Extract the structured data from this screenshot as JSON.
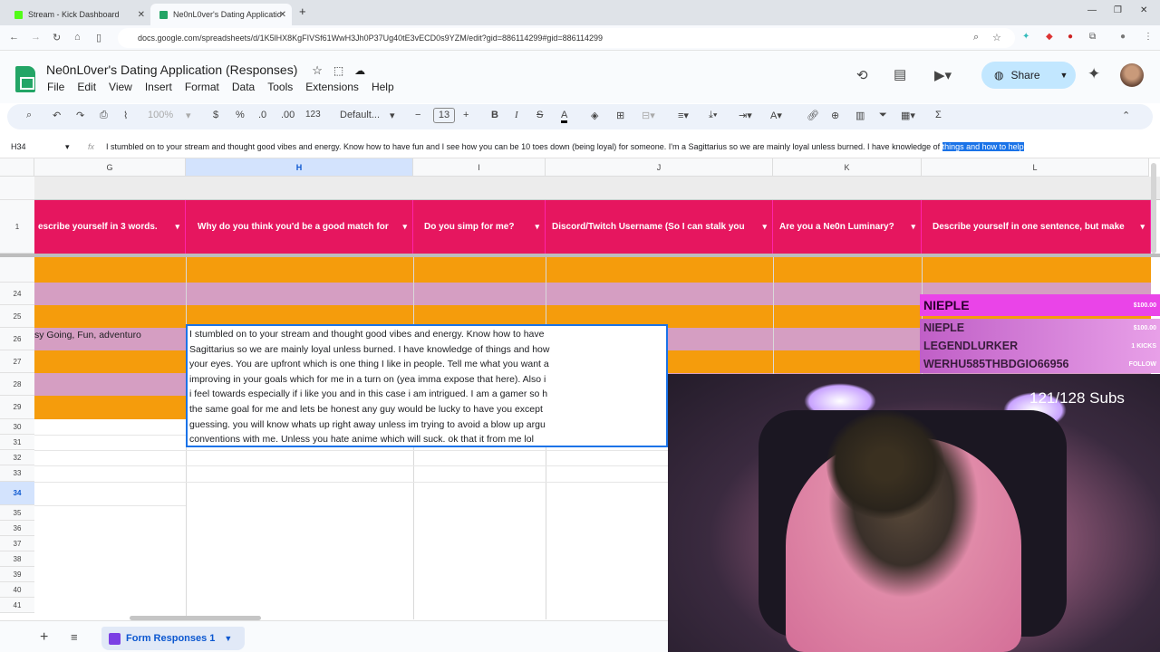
{
  "browser": {
    "tabs": [
      {
        "label": "Stream - Kick Dashboard",
        "favicon_color": "#53fc18"
      },
      {
        "label": "Ne0nL0ver's Dating Applicatio",
        "favicon_color": "#23a566"
      }
    ],
    "url": "docs.google.com/spreadsheets/d/1K5lHX8KgFIVSf61WwH3Jh0P37Ug40tE3vECD0s9YZM/edit?gid=886114299#gid=886114299"
  },
  "doc": {
    "title": "Ne0nL0ver's Dating Application (Responses)",
    "menus": [
      "File",
      "Edit",
      "View",
      "Insert",
      "Format",
      "Data",
      "Tools",
      "Extensions",
      "Help"
    ],
    "share_label": "Share"
  },
  "toolbar": {
    "zoom": "100%",
    "currency": "$",
    "percent": "%",
    "dec_decrease": ".0",
    "dec_increase": ".00",
    "number_format": "123",
    "font": "Default...",
    "font_size": "13",
    "bold": "B",
    "italic": "I"
  },
  "formula_bar": {
    "cell_ref": "H34",
    "fx": "fx",
    "text_before": "I stumbled on to your stream and thought good vibes and energy. Know how to have fun and I see how you can be 10 toes down (being loyal) for someone. I'm a Sagittarius so we are mainly loyal unless burned. I have knowledge of",
    "text_selected": "things and how to help"
  },
  "grid": {
    "columns": [
      "G",
      "H",
      "I",
      "J",
      "K",
      "L"
    ],
    "headers": [
      "escribe yourself in 3 words.",
      "Why do you think you'd be a good match for",
      "Do you simp for me?",
      "Discord/Twitch Username  (So I can stalk you",
      "Are you a Ne0n Luminary?",
      "Describe yourself in one sentence, but make"
    ],
    "row_numbers": [
      "1",
      "24",
      "25",
      "26",
      "27",
      "28",
      "29",
      "30",
      "31",
      "32",
      "33",
      "34",
      "35",
      "36",
      "37",
      "38",
      "39",
      "40",
      "41"
    ],
    "g34_text": "sy Going, Fun, adventuro",
    "h34_lines": [
      "I stumbled on to your stream and thought good vibes and energy. Know how to have",
      "Sagittarius so we are mainly loyal unless burned. I have knowledge of things and how",
      "your eyes. You are upfront which is one thing I like in people. Tell me what you want a",
      "improving in your goals which for me in a turn on (yea imma expose that here). Also i",
      "i feel towards especially if i like you and in this case i am intrigued. I am a gamer so h",
      "the same goal for me and lets be honest any guy would be lucky to have you except",
      "guessing. you will know whats up right away unless im trying to avoid a blow up argu",
      "conventions with me. Unless you hate anime which will suck. ok that it from me lol"
    ]
  },
  "sheet_tab": {
    "label": "Form Responses 1"
  },
  "overlay": {
    "recent": [
      {
        "name": "NIEPLE",
        "amount": "$100.00"
      },
      {
        "name": "NIEPLE",
        "amount": "$100.00"
      },
      {
        "name": "LEGENDLURKER",
        "amount": "1 KICKS"
      },
      {
        "name": "WERHU585THBDGIO66956",
        "amount": "FOLLOW"
      }
    ],
    "subs": "121/128 Subs"
  }
}
